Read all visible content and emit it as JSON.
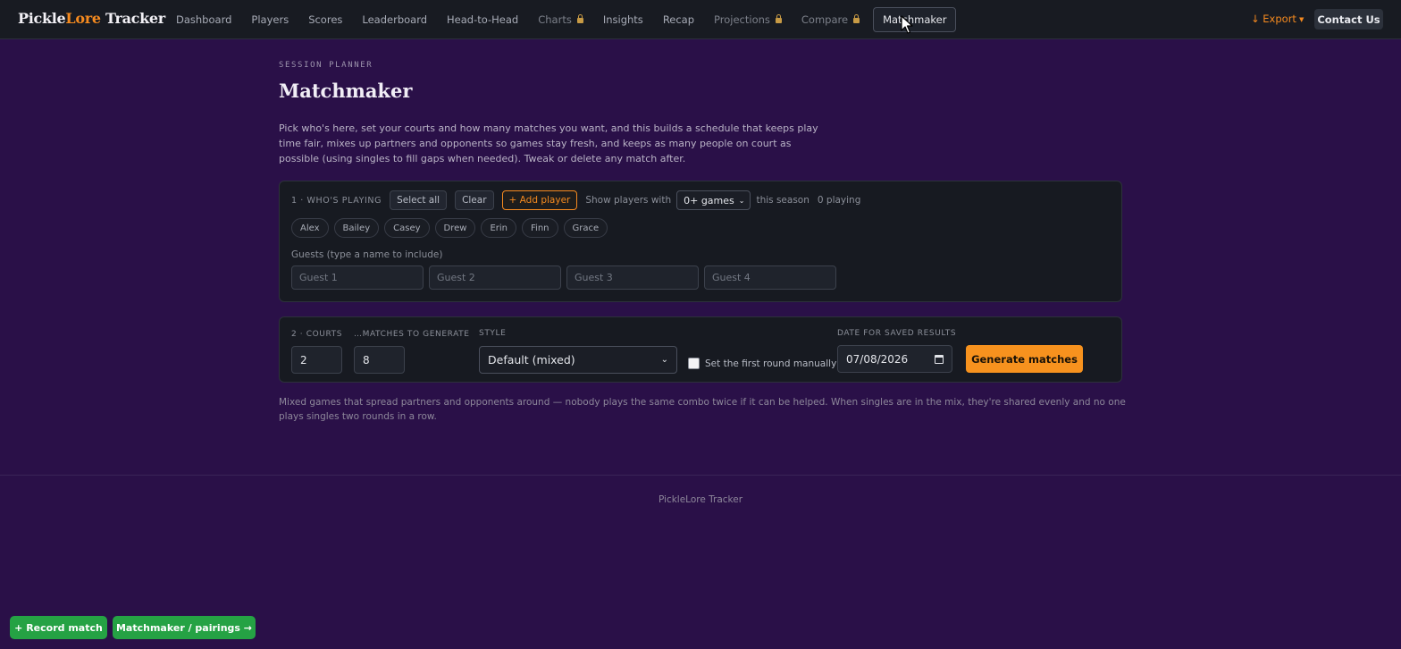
{
  "brand": {
    "part1": "Pickle",
    "part2": "Lore",
    "part3": " Tracker"
  },
  "nav": {
    "items": [
      {
        "label": "Dashboard",
        "locked": false,
        "active": false
      },
      {
        "label": "Players",
        "locked": false,
        "active": false
      },
      {
        "label": "Scores",
        "locked": false,
        "active": false
      },
      {
        "label": "Leaderboard",
        "locked": false,
        "active": false
      },
      {
        "label": "Head-to-Head",
        "locked": false,
        "active": false
      },
      {
        "label": "Charts",
        "locked": true,
        "active": false
      },
      {
        "label": "Insights",
        "locked": false,
        "active": false
      },
      {
        "label": "Recap",
        "locked": false,
        "active": false
      },
      {
        "label": "Projections",
        "locked": true,
        "active": false
      },
      {
        "label": "Compare",
        "locked": true,
        "active": false
      },
      {
        "label": "Matchmaker",
        "locked": false,
        "active": true
      }
    ],
    "export_label": "↓ Export",
    "contact_label": "Contact Us"
  },
  "page": {
    "eyebrow": "SESSION PLANNER",
    "title": "Matchmaker",
    "intro": "Pick who's here, set your courts and how many matches you want, and this builds a schedule that keeps play time fair, mixes up partners and opponents so games stay fresh, and keeps as many people on court as possible (using singles to fill gaps when needed). Tweak or delete any match after."
  },
  "whos_playing": {
    "step_label": "1 · WHO'S PLAYING",
    "select_all": "Select all",
    "clear": "Clear",
    "add_player": "+ Add player",
    "show_players_with": "Show players with",
    "games_filter": "0+ games",
    "this_season": "this season",
    "playing_count": "0 playing",
    "players": [
      "Alex",
      "Bailey",
      "Casey",
      "Drew",
      "Erin",
      "Finn",
      "Grace"
    ],
    "guests_label": "Guests (type a name to include)",
    "guest_placeholders": [
      "Guest 1",
      "Guest 2",
      "Guest 3",
      "Guest 4"
    ]
  },
  "settings": {
    "courts_label": "2 · COURTS",
    "courts_value": "2",
    "matches_label": "…MATCHES TO GENERATE",
    "matches_value": "8",
    "style_label": "STYLE",
    "style_value": "Default (mixed)",
    "manual_label": "Set the first round manually",
    "manual_checked": false,
    "date_label": "DATE FOR SAVED RESULTS",
    "date_value": "07/08/2026",
    "generate_label": "Generate matches"
  },
  "style_explain": "Mixed games that spread partners and opponents around — nobody plays the same combo twice if it can be helped. When singles are in the mix, they're shared evenly and no one plays singles two rounds in a row.",
  "footer": "PickleLore Tracker",
  "fabs": {
    "record": "+ Record match",
    "pairings": "Matchmaker / pairings →"
  },
  "colors": {
    "accent": "#f58a1f",
    "background": "#2a1048",
    "success": "#25a244"
  }
}
